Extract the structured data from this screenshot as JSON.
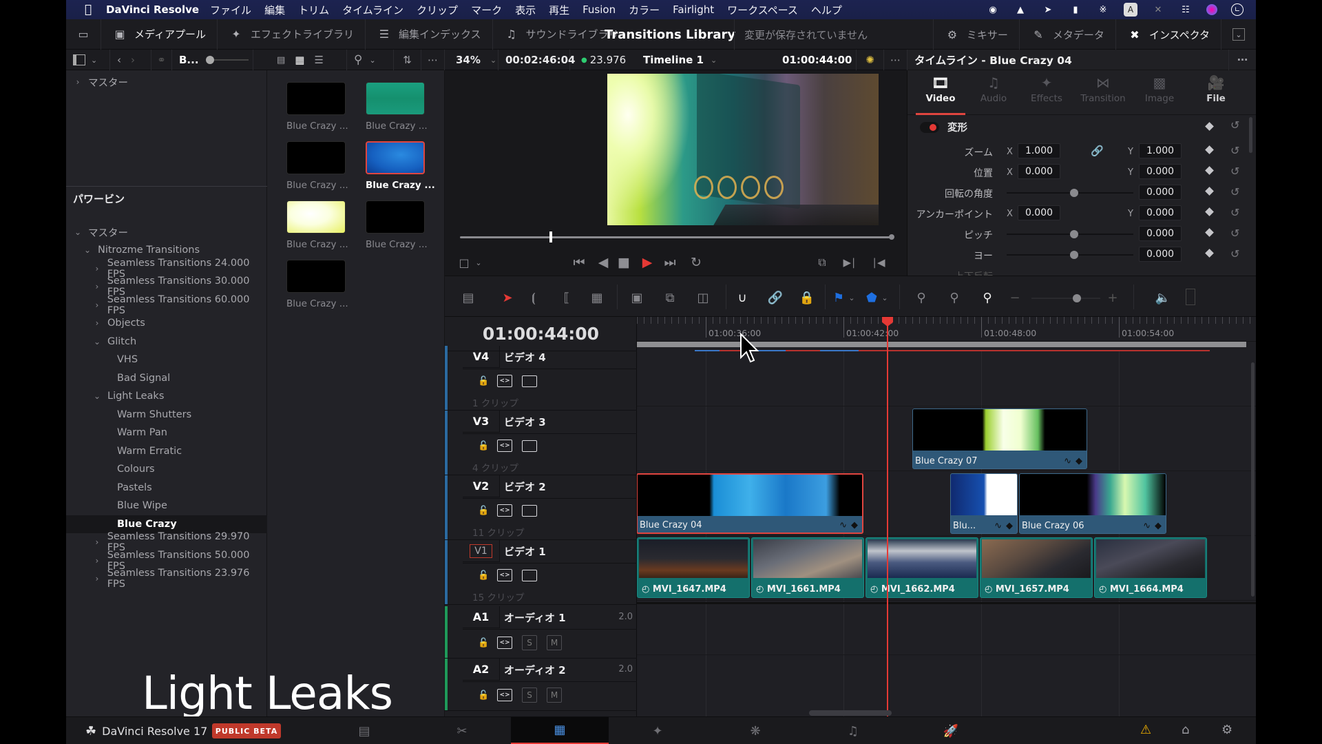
{
  "menubar": {
    "app_name": "DaVinci Resolve",
    "items": [
      "ファイル",
      "編集",
      "トリム",
      "タイムライン",
      "クリップ",
      "マーク",
      "表示",
      "再生",
      "Fusion",
      "カラー",
      "Fairlight",
      "ワークスペース",
      "ヘルプ"
    ]
  },
  "toolbar": {
    "media_pool": "メディアプール",
    "effects_library": "エフェクトライブラリ",
    "edit_index": "編集インデックス",
    "sound_library": "サウンドライブラリ",
    "title": "Transitions Library",
    "unsaved": "変更が保存されていません",
    "mixer": "ミキサー",
    "metadata": "メタデータ",
    "inspector": "インスペクタ"
  },
  "subbar": {
    "bin_short": "B...",
    "zoom_level": "34%",
    "source_timecode": "00:02:46:04",
    "frame_rate": "23.976",
    "timeline_name": "Timeline 1",
    "record_timecode": "01:00:44:00"
  },
  "bin_tree": {
    "top_master": "マスター",
    "power_bins": "パワービン",
    "master": "マスター",
    "items": [
      {
        "label": "Nitrozme Transitions",
        "level": 1,
        "expanded": true
      },
      {
        "label": "Seamless Transitions 24.000 FPS",
        "level": 2,
        "expanded": false
      },
      {
        "label": "Seamless Transitions 30.000 FPS",
        "level": 2,
        "expanded": false
      },
      {
        "label": "Seamless Transitions 60.000 FPS",
        "level": 2,
        "expanded": false
      },
      {
        "label": "Objects",
        "level": 2,
        "expanded": false
      },
      {
        "label": "Glitch",
        "level": 2,
        "expanded": true
      },
      {
        "label": "VHS",
        "level": 3
      },
      {
        "label": "Bad Signal",
        "level": 3
      },
      {
        "label": "Light Leaks",
        "level": 2,
        "expanded": true
      },
      {
        "label": "Warm Shutters",
        "level": 3
      },
      {
        "label": "Warm Pan",
        "level": 3
      },
      {
        "label": "Warm Erratic",
        "level": 3
      },
      {
        "label": "Colours",
        "level": 3
      },
      {
        "label": "Pastels",
        "level": 3
      },
      {
        "label": "Blue Wipe",
        "level": 3
      },
      {
        "label": "Blue Crazy",
        "level": 3,
        "selected": true
      },
      {
        "label": "Seamless Transitions 29.970 FPS",
        "level": 2,
        "expanded": false
      },
      {
        "label": "Seamless Transitions 50.000 FPS",
        "level": 2,
        "expanded": false
      },
      {
        "label": "Seamless Transitions 23.976 FPS",
        "level": 2,
        "expanded": false
      }
    ]
  },
  "media_thumbs": [
    {
      "label": "Blue Crazy ...",
      "color": "#000000"
    },
    {
      "label": "Blue Crazy ...",
      "color": "#1a9478"
    },
    {
      "label": "Blue Crazy ...",
      "color": "#000000"
    },
    {
      "label": "Blue Crazy ...",
      "color": "#1e74c8",
      "selected": true
    },
    {
      "label": "Blue Crazy ...",
      "color": "#f0f6a0"
    },
    {
      "label": "Blue Crazy ...",
      "color": "#000000"
    },
    {
      "label": "Blue Crazy ...",
      "color": "#000000"
    }
  ],
  "inspector": {
    "header": "タイムライン - Blue Crazy 04",
    "tabs": [
      {
        "label": "Video",
        "icon": "film-icon",
        "active": true
      },
      {
        "label": "Audio",
        "icon": "music-icon"
      },
      {
        "label": "Effects",
        "icon": "magic-wand-icon"
      },
      {
        "label": "Transition",
        "icon": "transition-icon"
      },
      {
        "label": "Image",
        "icon": "image-icon"
      },
      {
        "label": "File",
        "icon": "camera-icon"
      }
    ],
    "section": "変形",
    "params": {
      "zoom": {
        "label": "ズーム",
        "x": "1.000",
        "y": "1.000"
      },
      "position": {
        "label": "位置",
        "x": "0.000",
        "y": "0.000"
      },
      "rotation": {
        "label": "回転の角度",
        "value": "0.000"
      },
      "anchor": {
        "label": "アンカーポイント",
        "x": "0.000",
        "y": "0.000"
      },
      "pitch": {
        "label": "ピッチ",
        "value": "0.000"
      },
      "yaw": {
        "label": "ヨー",
        "value": "0.000"
      },
      "flip": {
        "label": "上下反転"
      }
    },
    "axis_x": "X",
    "axis_y": "Y"
  },
  "timeline": {
    "current_timecode": "01:00:44:00",
    "ruler_labels": [
      "01:00:36:00",
      "01:00:42:00",
      "01:00:48:00",
      "01:00:54:00"
    ],
    "tracks": [
      {
        "id": "V4",
        "name": "ビデオ 4",
        "count": "1 クリップ",
        "type": "video"
      },
      {
        "id": "V3",
        "name": "ビデオ 3",
        "count": "4 クリップ",
        "type": "video"
      },
      {
        "id": "V2",
        "name": "ビデオ 2",
        "count": "11 クリップ",
        "type": "video"
      },
      {
        "id": "V1",
        "name": "ビデオ 1",
        "count": "15 クリップ",
        "type": "video",
        "dest": true
      },
      {
        "id": "A1",
        "name": "オーディオ 1",
        "channels": "2.0",
        "type": "audio"
      },
      {
        "id": "A2",
        "name": "オーディオ 2",
        "channels": "2.0",
        "type": "audio"
      }
    ],
    "solo": "S",
    "mute": "M",
    "clips_v3": [
      {
        "name": "Blue Crazy 07"
      }
    ],
    "clips_v2": [
      {
        "name": "Blue Crazy 04",
        "selected": true
      },
      {
        "name": "Blu..."
      },
      {
        "name": "Blue Crazy 06"
      }
    ],
    "clips_v1": [
      {
        "name": "MVI_1647.MP4"
      },
      {
        "name": "MVI_1661.MP4"
      },
      {
        "name": "MVI_1662.MP4"
      },
      {
        "name": "MVI_1657.MP4"
      },
      {
        "name": "MVI_1664.MP4"
      }
    ]
  },
  "pagebar": {
    "brand": "DaVinci Resolve 17",
    "beta": "PUBLIC BETA",
    "pages": [
      "media",
      "cut",
      "edit",
      "fusion",
      "color",
      "fairlight",
      "deliver"
    ],
    "active_page": "edit"
  },
  "overlay": {
    "caption": "Light Leaks"
  },
  "colors": {
    "accent_red": "#e53935",
    "clip_blue": "#2f5878",
    "clip_teal": "#14706c",
    "selected_border": "#e0453f"
  }
}
